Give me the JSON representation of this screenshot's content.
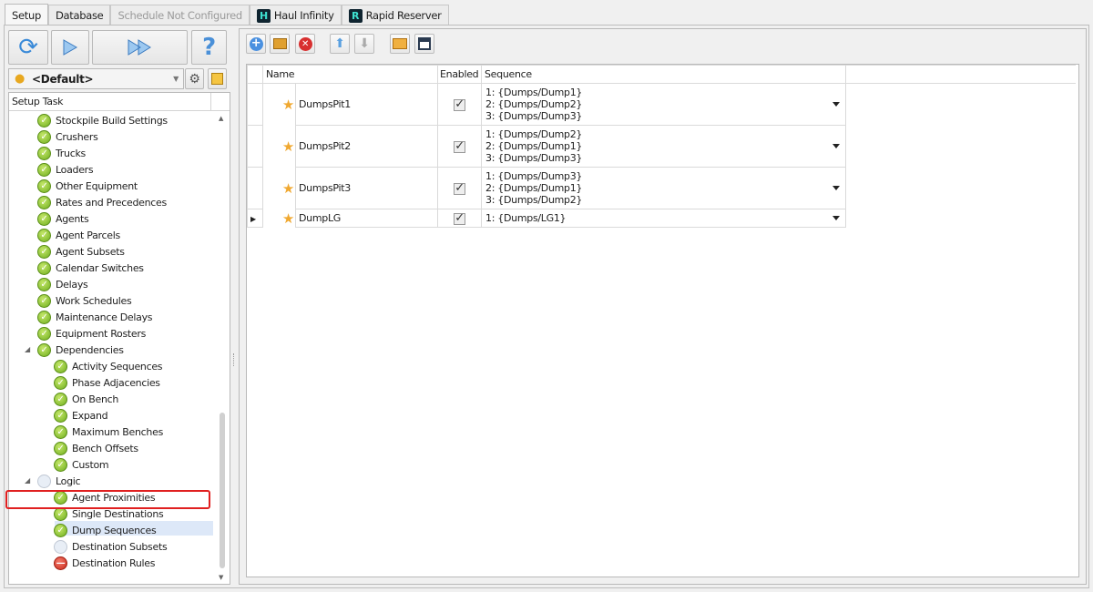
{
  "tabs": [
    {
      "label": "Setup",
      "state": "active"
    },
    {
      "label": "Database",
      "state": "normal"
    },
    {
      "label": "Schedule Not Configured",
      "state": "disabled"
    },
    {
      "label": "Haul Infinity",
      "state": "normal",
      "logo": "H"
    },
    {
      "label": "Rapid Reserver",
      "state": "normal",
      "logo": "R"
    }
  ],
  "left": {
    "scenario": "<Default>",
    "tree_header": "Setup Task",
    "tree": [
      {
        "label": "Stockpile Build Settings",
        "status": "ok",
        "level": 1
      },
      {
        "label": "Crushers",
        "status": "ok",
        "level": 1
      },
      {
        "label": "Trucks",
        "status": "ok",
        "level": 1
      },
      {
        "label": "Loaders",
        "status": "ok",
        "level": 1
      },
      {
        "label": "Other Equipment",
        "status": "ok",
        "level": 1
      },
      {
        "label": "Rates and Precedences",
        "status": "ok",
        "level": 1
      },
      {
        "label": "Agents",
        "status": "ok",
        "level": 1
      },
      {
        "label": "Agent Parcels",
        "status": "ok",
        "level": 1
      },
      {
        "label": "Agent Subsets",
        "status": "ok",
        "level": 1
      },
      {
        "label": "Calendar Switches",
        "status": "ok",
        "level": 1
      },
      {
        "label": "Delays",
        "status": "ok",
        "level": 1
      },
      {
        "label": "Work Schedules",
        "status": "ok",
        "level": 1
      },
      {
        "label": "Maintenance Delays",
        "status": "ok",
        "level": 1
      },
      {
        "label": "Equipment Rosters",
        "status": "ok",
        "level": 1
      },
      {
        "label": "Dependencies",
        "status": "ok",
        "level": 1,
        "expanded": true
      },
      {
        "label": "Activity Sequences",
        "status": "ok",
        "level": 2
      },
      {
        "label": "Phase Adjacencies",
        "status": "ok",
        "level": 2
      },
      {
        "label": "On Bench",
        "status": "ok",
        "level": 2
      },
      {
        "label": "Expand",
        "status": "ok",
        "level": 2
      },
      {
        "label": "Maximum Benches",
        "status": "ok",
        "level": 2
      },
      {
        "label": "Bench Offsets",
        "status": "ok",
        "level": 2
      },
      {
        "label": "Custom",
        "status": "ok",
        "level": 2
      },
      {
        "label": "Logic",
        "status": "none",
        "level": 1,
        "expanded": true
      },
      {
        "label": "Agent Proximities",
        "status": "ok",
        "level": 2
      },
      {
        "label": "Single Destinations",
        "status": "ok",
        "level": 2
      },
      {
        "label": "Dump Sequences",
        "status": "ok",
        "level": 2,
        "selected": true
      },
      {
        "label": "Destination Subsets",
        "status": "none",
        "level": 2
      },
      {
        "label": "Destination Rules",
        "status": "error",
        "level": 2
      }
    ]
  },
  "grid": {
    "columns": [
      "Name",
      "Enabled",
      "Sequence"
    ],
    "rows": [
      {
        "name": "DumpsPit1",
        "enabled": true,
        "sequence": [
          "1: {Dumps/Dump1}",
          "2: {Dumps/Dump2}",
          "3: {Dumps/Dump3}"
        ]
      },
      {
        "name": "DumpsPit2",
        "enabled": true,
        "sequence": [
          "1: {Dumps/Dump2}",
          "2: {Dumps/Dump1}",
          "3: {Dumps/Dump3}"
        ]
      },
      {
        "name": "DumpsPit3",
        "enabled": true,
        "sequence": [
          "1: {Dumps/Dump3}",
          "2: {Dumps/Dump1}",
          "3: {Dumps/Dump2}"
        ]
      },
      {
        "name": "DumpLG",
        "enabled": true,
        "current": true,
        "sequence": [
          "1: {Dumps/LG1}"
        ]
      }
    ]
  }
}
